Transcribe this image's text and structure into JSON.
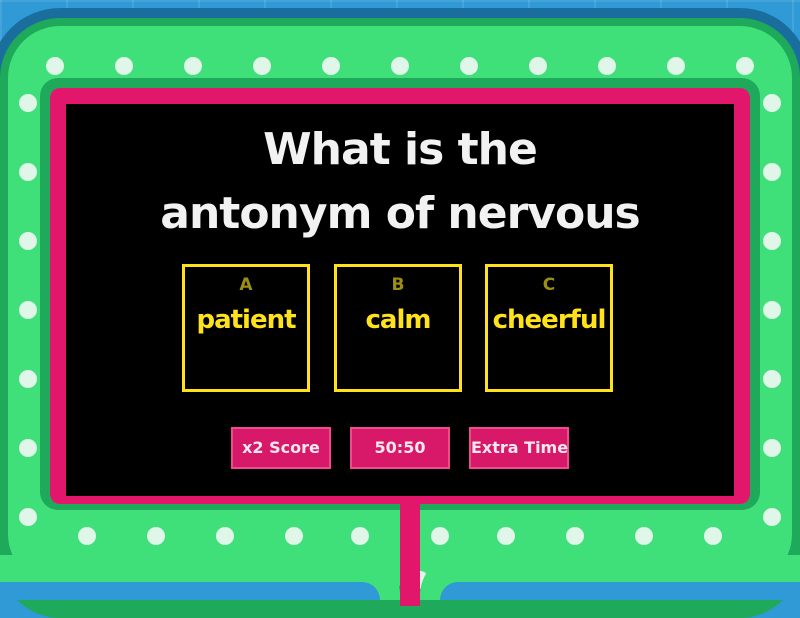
{
  "question": {
    "line1": "What is the",
    "line2": "antonym of nervous"
  },
  "answers": [
    {
      "letter": "A",
      "text": "patient"
    },
    {
      "letter": "B",
      "text": "calm"
    },
    {
      "letter": "C",
      "text": "cheerful"
    }
  ],
  "powerups": [
    {
      "label": "x2 Score"
    },
    {
      "label": "50:50"
    },
    {
      "label": "Extra Time"
    }
  ],
  "colors": {
    "background": "#2f9ad6",
    "board_green": "#3fe07a",
    "board_dark_green": "#1fa95a",
    "frame_pink": "#e2176b",
    "screen": "#000000",
    "answer_yellow": "#ffe21a"
  }
}
